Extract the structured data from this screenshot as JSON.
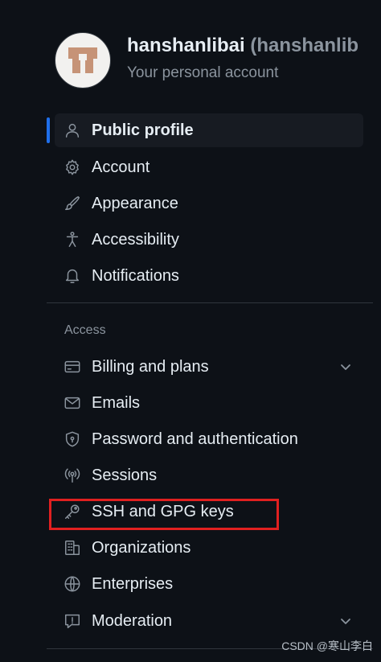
{
  "header": {
    "username": "hanshanlibai",
    "handle": "(hanshanlib",
    "subtitle": "Your personal account"
  },
  "nav": {
    "public_profile": "Public profile",
    "account": "Account",
    "appearance": "Appearance",
    "accessibility": "Accessibility",
    "notifications": "Notifications",
    "access_heading": "Access",
    "billing": "Billing and plans",
    "emails": "Emails",
    "password_auth": "Password and authentication",
    "sessions": "Sessions",
    "ssh_gpg": "SSH and GPG keys",
    "organizations": "Organizations",
    "enterprises": "Enterprises",
    "moderation": "Moderation"
  },
  "icons": {
    "public_profile": "person-icon",
    "account": "gear-icon",
    "appearance": "paintbrush-icon",
    "accessibility": "accessibility-icon",
    "notifications": "bell-icon",
    "billing": "credit-card-icon",
    "emails": "mail-icon",
    "password_auth": "shield-lock-icon",
    "sessions": "broadcast-icon",
    "ssh_gpg": "key-icon",
    "organizations": "organization-icon",
    "enterprises": "globe-icon",
    "moderation": "report-icon"
  },
  "watermark": "CSDN @寒山李白",
  "colors": {
    "background": "#0d1117",
    "active_indicator": "#1f6feb",
    "highlight_box": "#e02020",
    "muted_text": "#8b949e"
  }
}
